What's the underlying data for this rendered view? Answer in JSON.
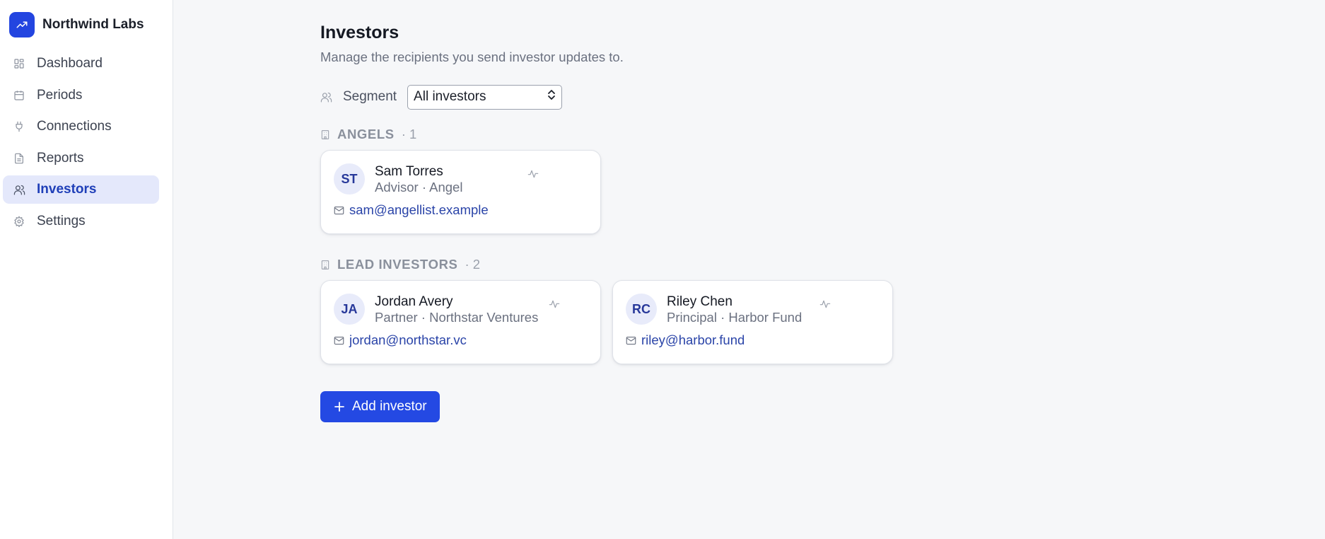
{
  "brand": {
    "name": "Northwind Labs",
    "logo_icon": "trending-up-icon",
    "logo_color": "#2345e0"
  },
  "sidebar": {
    "items": [
      {
        "label": "Dashboard",
        "icon": "dashboard-grid-icon",
        "active": false
      },
      {
        "label": "Periods",
        "icon": "calendar-icon",
        "active": false
      },
      {
        "label": "Connections",
        "icon": "plug-icon",
        "active": false
      },
      {
        "label": "Reports",
        "icon": "document-icon",
        "active": false
      },
      {
        "label": "Investors",
        "icon": "users-icon",
        "active": true
      },
      {
        "label": "Settings",
        "icon": "gear-icon",
        "active": false
      }
    ]
  },
  "page": {
    "title": "Investors",
    "subtitle": "Manage the recipients you send investor updates to."
  },
  "segment": {
    "label": "Segment",
    "selected": "All investors"
  },
  "groups": [
    {
      "name": "ANGELS",
      "count": "· 1",
      "investors": [
        {
          "initials": "ST",
          "name": "Sam Torres",
          "role": "Advisor · Angel",
          "email": "sam@angellist.example"
        }
      ]
    },
    {
      "name": "LEAD INVESTORS",
      "count": "· 2",
      "investors": [
        {
          "initials": "JA",
          "name": "Jordan Avery",
          "role": "Partner · Northstar Ventures",
          "email": "jordan@northstar.vc"
        },
        {
          "initials": "RC",
          "name": "Riley Chen",
          "role": "Principal · Harbor Fund",
          "email": "riley@harbor.fund"
        }
      ]
    }
  ],
  "actions": {
    "add_investor": "Add investor"
  },
  "colors": {
    "accent": "#2449e3",
    "active_nav_bg": "#e4e8fb",
    "link": "#2a44a8"
  }
}
